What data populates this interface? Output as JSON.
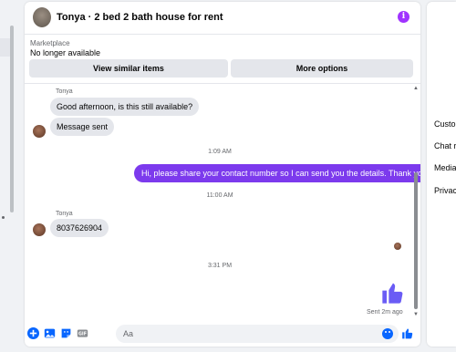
{
  "header": {
    "title": "Tonya · 2 bed 2 bath house for rent",
    "info_glyph": "i"
  },
  "listing": {
    "label": "Marketplace",
    "status": "No longer available",
    "buttons": {
      "view_similar": "View similar items",
      "more_options": "More options"
    }
  },
  "messages": {
    "sender_name_1": "Tonya",
    "incoming_1": "Good afternoon, is this still available?",
    "incoming_2": "Message sent",
    "time_1": "1:09 AM",
    "outgoing_1": "Hi, please share your contact number so I can send you the details. Thank you!",
    "time_2": "11:00 AM",
    "sender_name_2": "Tonya",
    "incoming_3": "8037626904",
    "time_3": "3:31 PM",
    "sent_status": "Sent 2m ago"
  },
  "composer": {
    "placeholder": "Aa",
    "icons": [
      "plus-icon",
      "photo-icon",
      "sticker-icon",
      "gif-icon",
      "emoji-icon",
      "like-icon"
    ]
  },
  "right_panel": {
    "items": [
      "Custo",
      "Chat r",
      "Media",
      "Privac"
    ]
  },
  "colors": {
    "accent": "#7c3aed",
    "brand_blue": "#0866ff",
    "info_purple": "#a033ff",
    "bubble_in": "#e4e6eb"
  }
}
